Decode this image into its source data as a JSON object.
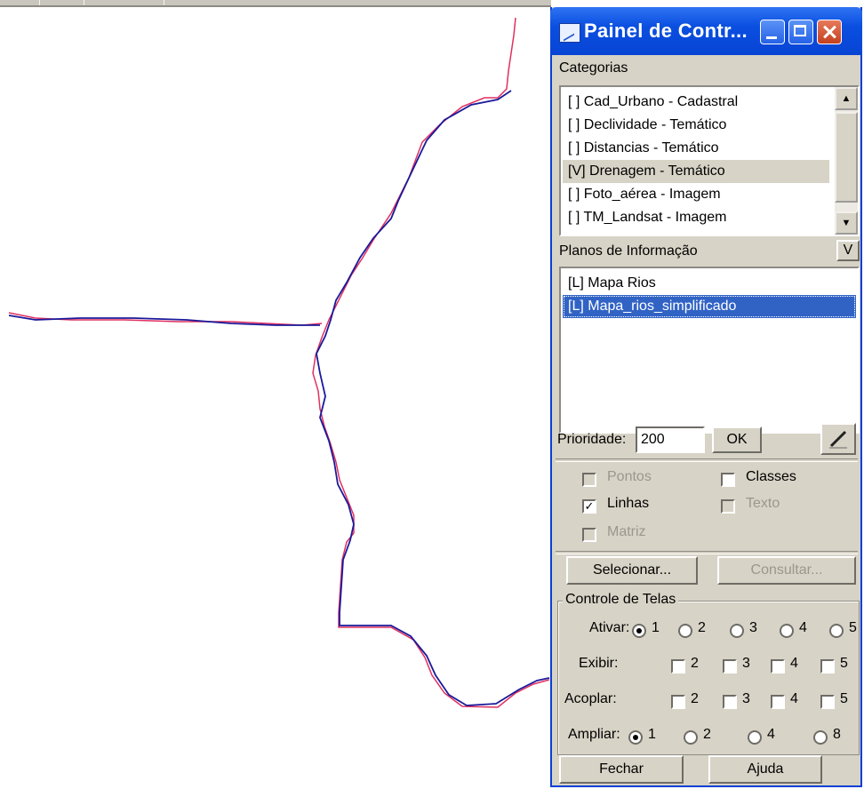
{
  "window": {
    "title": "Painel de Contr...",
    "icons": {
      "app": "map-app-icon",
      "minimize": "minimize-icon",
      "maximize": "maximize-icon",
      "close": "close-icon"
    }
  },
  "categorias": {
    "label": "Categorias",
    "items": [
      "[ ] Cad_Urbano - Cadastral",
      "[ ] Declividade - Temático",
      "[ ] Distancias - Temático",
      "[V] Drenagem - Temático",
      "[ ] Foto_aérea - Imagem",
      "[ ] TM_Landsat - Imagem"
    ],
    "selected_index": 3
  },
  "planos": {
    "label": "Planos de Informação",
    "toggle_label": "V",
    "items": [
      "[L] Mapa Rios",
      "[L] Mapa_rios_simplificado"
    ],
    "selected_index": 1
  },
  "prioridade": {
    "label": "Prioridade:",
    "value": "200",
    "ok_label": "OK"
  },
  "representacoes": {
    "pontos": "Pontos",
    "classes": "Classes",
    "linhas": "Linhas",
    "texto": "Texto",
    "matriz": "Matriz",
    "linhas_checked": true
  },
  "actions": {
    "selecionar": "Selecionar...",
    "consultar": "Consultar..."
  },
  "controle": {
    "title": "Controle de Telas",
    "ativar_label": "Ativar:",
    "exibir_label": "Exibir:",
    "acoplar_label": "Acoplar:",
    "ampliar_label": "Ampliar:",
    "ativar_options": [
      "1",
      "2",
      "3",
      "4",
      "5"
    ],
    "ativar_selected": "1",
    "exibir_options": [
      "2",
      "3",
      "4",
      "5"
    ],
    "acoplar_options": [
      "2",
      "3",
      "4",
      "5"
    ],
    "ampliar_options": [
      "1",
      "2",
      "4",
      "8"
    ],
    "ampliar_selected": "1"
  },
  "footer": {
    "fechar": "Fechar",
    "ajuda": "Ajuda"
  },
  "colors": {
    "titlebar": "#0a4fe0",
    "river_original": "#e03060",
    "river_simplified": "#1a1a9a",
    "selection": "#3163c5"
  }
}
